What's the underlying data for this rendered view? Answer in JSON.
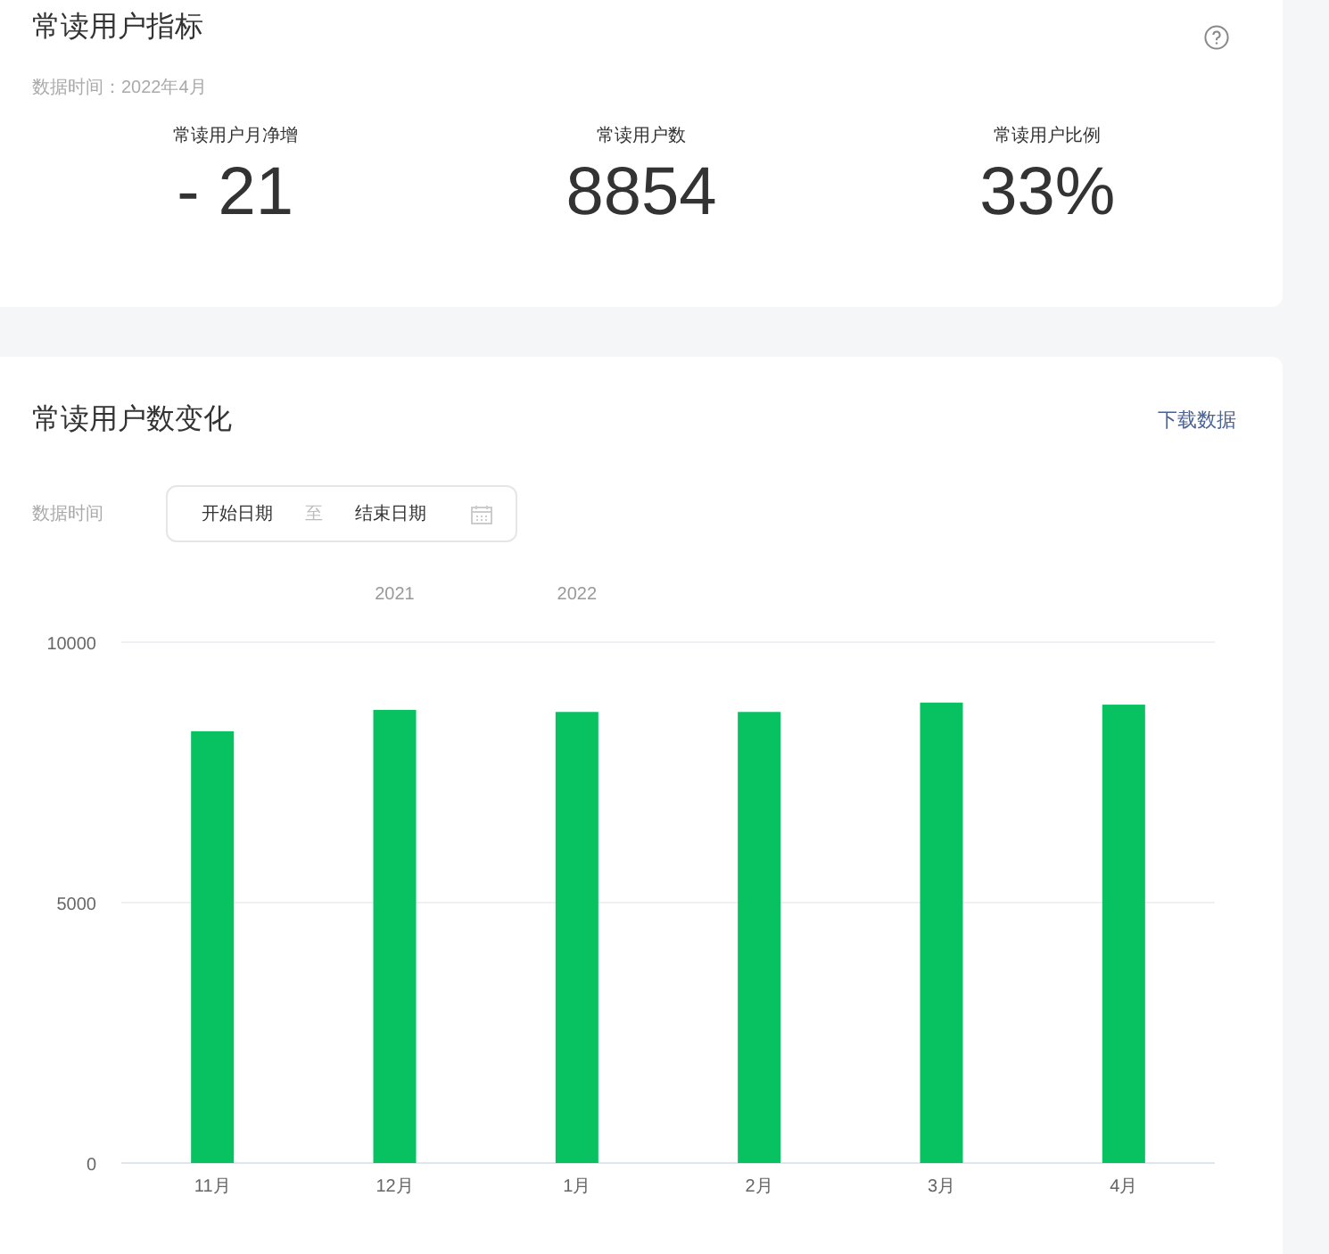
{
  "metrics_card": {
    "title": "常读用户指标",
    "data_time": "数据时间：2022年4月",
    "metrics": [
      {
        "label": "常读用户月净增",
        "value": "- 21"
      },
      {
        "label": "常读用户数",
        "value": "8854"
      },
      {
        "label": "常读用户比例",
        "value": "33%"
      }
    ]
  },
  "trend_card": {
    "title": "常读用户数变化",
    "download_link": "下载数据",
    "filter_label": "数据时间",
    "date_range": {
      "start_placeholder": "开始日期",
      "separator": "至",
      "end_placeholder": "结束日期"
    },
    "chart_data": {
      "type": "bar",
      "categories": [
        "11月",
        "12月",
        "1月",
        "2月",
        "3月",
        "4月"
      ],
      "series": [
        {
          "color": "#08c161",
          "values": [
            8290,
            8700,
            8660,
            8660,
            8840,
            8800
          ]
        }
      ],
      "ylim": [
        0,
        10000
      ],
      "yticks": [
        0,
        5000,
        10000
      ],
      "annotations": [
        "2021",
        "2022"
      ]
    }
  }
}
